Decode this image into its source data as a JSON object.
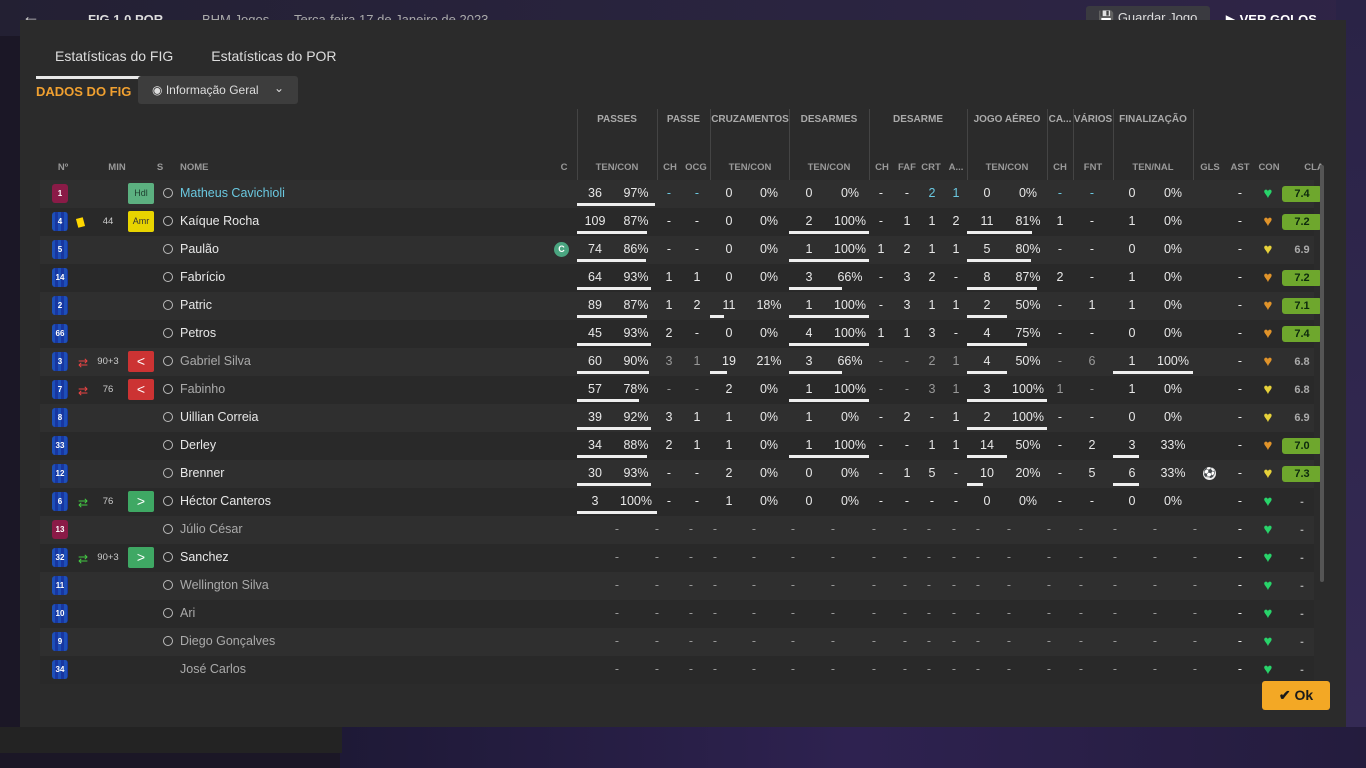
{
  "topbar": {
    "back_icon": "arrow-left-icon",
    "score": "FIG   1   0   POR",
    "stadium": "BHM Jogos",
    "date": "Terça-feira 17 de Janeiro de 2023",
    "save_label": "Guardar Jogo",
    "golos_label": "VER GOLOS"
  },
  "tabs": [
    {
      "label": "Estatísticas do FIG",
      "active": true
    },
    {
      "label": "Estatísticas do POR",
      "active": false
    }
  ],
  "section_title": "DADOS DO FIG",
  "view_dropdown": {
    "label": "Informação Geral",
    "icon": "eye-icon"
  },
  "group_headers": [
    "PASSES",
    "PASSE",
    "CRUZAMENTOS",
    "DESARMES",
    "DESARME",
    "JOGO AÉREO",
    "CA...",
    "VÁRIOS",
    "FINALIZAÇÃO"
  ],
  "column_headers": {
    "num": "Nº",
    "min": "MIN",
    "s": "S",
    "name": "NOME",
    "c": "C",
    "passes": "TEN/CON",
    "ch1": "CH",
    "ocg": "OCG",
    "cruz": "TEN/CON",
    "desarmes": "TEN/CON",
    "ch2": "CH",
    "faf": "FAF",
    "crt": "CRT",
    "a": "A...",
    "aereo": "TEN/CON",
    "ch3": "CH",
    "fnt": "FNT",
    "fin": "TEN/NAL",
    "gls": "GLS",
    "ast": "AST",
    "con": "CON",
    "cla": "CLA"
  },
  "players": [
    {
      "num": "1",
      "kit": "gk",
      "min": "",
      "sub": "",
      "card": "",
      "badge": "Hdl",
      "badge_type": "hdl",
      "name": "Matheus Cavichioli",
      "name_style": "blue",
      "cap": false,
      "pass_t": "36",
      "pass_p": "97%",
      "pass_f": 0.97,
      "ch1": "-",
      "ocg": "-",
      "cr_t": "0",
      "cr_p": "0%",
      "cr_f": 0,
      "de_t": "0",
      "de_p": "0%",
      "de_f": 0,
      "ch2": "-",
      "faf": "-",
      "crt": "2",
      "a": "1",
      "ae_t": "0",
      "ae_p": "0%",
      "ae_f": 0,
      "ch3": "-",
      "fnt": "-",
      "fi_t": "0",
      "fi_p": "0%",
      "fi_f": 0,
      "gls": "",
      "ast": "-",
      "con": "green",
      "cla": "7.4",
      "cla_style": "g",
      "blue_cells": true
    },
    {
      "num": "4",
      "kit": "out",
      "min": "44",
      "sub": "",
      "card": "yellow",
      "badge": "Amr",
      "badge_type": "amr",
      "name": "Kaíque Rocha",
      "name_style": "",
      "cap": false,
      "pass_t": "109",
      "pass_p": "87%",
      "pass_f": 0.87,
      "ch1": "-",
      "ocg": "-",
      "cr_t": "0",
      "cr_p": "0%",
      "cr_f": 0,
      "de_t": "2",
      "de_p": "100%",
      "de_f": 1,
      "ch2": "-",
      "faf": "1",
      "crt": "1",
      "a": "2",
      "ae_t": "11",
      "ae_p": "81%",
      "ae_f": 0.81,
      "ch3": "1",
      "fnt": "-",
      "fi_t": "1",
      "fi_p": "0%",
      "fi_f": 0,
      "gls": "",
      "ast": "-",
      "con": "orange",
      "cla": "7.2",
      "cla_style": "g"
    },
    {
      "num": "5",
      "kit": "out",
      "min": "",
      "sub": "",
      "card": "",
      "badge": "",
      "badge_type": "",
      "name": "Paulão",
      "name_style": "",
      "cap": true,
      "pass_t": "74",
      "pass_p": "86%",
      "pass_f": 0.86,
      "ch1": "-",
      "ocg": "-",
      "cr_t": "0",
      "cr_p": "0%",
      "cr_f": 0,
      "de_t": "1",
      "de_p": "100%",
      "de_f": 1,
      "ch2": "1",
      "faf": "2",
      "crt": "1",
      "a": "1",
      "ae_t": "5",
      "ae_p": "80%",
      "ae_f": 0.8,
      "ch3": "-",
      "fnt": "-",
      "fi_t": "0",
      "fi_p": "0%",
      "fi_f": 0,
      "gls": "",
      "ast": "-",
      "con": "yellow",
      "cla": "6.9",
      "cla_style": "n"
    },
    {
      "num": "14",
      "kit": "out",
      "min": "",
      "sub": "",
      "card": "",
      "badge": "",
      "badge_type": "",
      "name": "Fabrício",
      "name_style": "",
      "cap": false,
      "pass_t": "64",
      "pass_p": "93%",
      "pass_f": 0.93,
      "ch1": "1",
      "ocg": "1",
      "cr_t": "0",
      "cr_p": "0%",
      "cr_f": 0,
      "de_t": "3",
      "de_p": "66%",
      "de_f": 0.66,
      "ch2": "-",
      "faf": "3",
      "crt": "2",
      "a": "-",
      "ae_t": "8",
      "ae_p": "87%",
      "ae_f": 0.87,
      "ch3": "2",
      "fnt": "-",
      "fi_t": "1",
      "fi_p": "0%",
      "fi_f": 0,
      "gls": "",
      "ast": "-",
      "con": "orange",
      "cla": "7.2",
      "cla_style": "g"
    },
    {
      "num": "2",
      "kit": "out",
      "min": "",
      "sub": "",
      "card": "",
      "badge": "",
      "badge_type": "",
      "name": "Patric",
      "name_style": "",
      "cap": false,
      "pass_t": "89",
      "pass_p": "87%",
      "pass_f": 0.87,
      "ch1": "1",
      "ocg": "2",
      "cr_t": "11",
      "cr_p": "18%",
      "cr_f": 0.18,
      "de_t": "1",
      "de_p": "100%",
      "de_f": 1,
      "ch2": "-",
      "faf": "3",
      "crt": "1",
      "a": "1",
      "ae_t": "2",
      "ae_p": "50%",
      "ae_f": 0.5,
      "ch3": "-",
      "fnt": "1",
      "fi_t": "1",
      "fi_p": "0%",
      "fi_f": 0,
      "gls": "",
      "ast": "-",
      "con": "orange",
      "cla": "7.1",
      "cla_style": "g"
    },
    {
      "num": "66",
      "kit": "out",
      "min": "",
      "sub": "",
      "card": "",
      "badge": "",
      "badge_type": "",
      "name": "Petros",
      "name_style": "",
      "cap": false,
      "pass_t": "45",
      "pass_p": "93%",
      "pass_f": 0.93,
      "ch1": "2",
      "ocg": "-",
      "cr_t": "0",
      "cr_p": "0%",
      "cr_f": 0,
      "de_t": "4",
      "de_p": "100%",
      "de_f": 1,
      "ch2": "1",
      "faf": "1",
      "crt": "3",
      "a": "-",
      "ae_t": "4",
      "ae_p": "75%",
      "ae_f": 0.75,
      "ch3": "-",
      "fnt": "-",
      "fi_t": "0",
      "fi_p": "0%",
      "fi_f": 0,
      "gls": "",
      "ast": "-",
      "con": "orange",
      "cla": "7.4",
      "cla_style": "g"
    },
    {
      "num": "3",
      "kit": "out",
      "min": "90+3",
      "sub": "out",
      "card": "",
      "badge": "<",
      "badge_type": "off",
      "name": "Gabriel Silva",
      "name_style": "dim",
      "cap": false,
      "pass_t": "60",
      "pass_p": "90%",
      "pass_f": 0.9,
      "ch1": "3",
      "ocg": "1",
      "cr_t": "19",
      "cr_p": "21%",
      "cr_f": 0.21,
      "de_t": "3",
      "de_p": "66%",
      "de_f": 0.66,
      "ch2": "-",
      "faf": "-",
      "crt": "2",
      "a": "1",
      "ae_t": "4",
      "ae_p": "50%",
      "ae_f": 0.5,
      "ch3": "-",
      "fnt": "6",
      "fi_t": "1",
      "fi_p": "100%",
      "fi_f": 1,
      "gls": "",
      "ast": "-",
      "con": "orange",
      "cla": "6.8",
      "cla_style": "n",
      "dim_cells": true
    },
    {
      "num": "7",
      "kit": "out",
      "min": "76",
      "sub": "out",
      "card": "",
      "badge": "<",
      "badge_type": "off",
      "name": "Fabinho",
      "name_style": "dim",
      "cap": false,
      "pass_t": "57",
      "pass_p": "78%",
      "pass_f": 0.78,
      "ch1": "-",
      "ocg": "-",
      "cr_t": "2",
      "cr_p": "0%",
      "cr_f": 0,
      "de_t": "1",
      "de_p": "100%",
      "de_f": 1,
      "ch2": "-",
      "faf": "-",
      "crt": "3",
      "a": "1",
      "ae_t": "3",
      "ae_p": "100%",
      "ae_f": 1,
      "ch3": "1",
      "fnt": "-",
      "fi_t": "1",
      "fi_p": "0%",
      "fi_f": 0,
      "gls": "",
      "ast": "-",
      "con": "yellow",
      "cla": "6.8",
      "cla_style": "n",
      "dim_cells": true
    },
    {
      "num": "8",
      "kit": "out",
      "min": "",
      "sub": "",
      "card": "",
      "badge": "",
      "badge_type": "",
      "name": "Uillian Correia",
      "name_style": "",
      "cap": false,
      "pass_t": "39",
      "pass_p": "92%",
      "pass_f": 0.92,
      "ch1": "3",
      "ocg": "1",
      "cr_t": "1",
      "cr_p": "0%",
      "cr_f": 0,
      "de_t": "1",
      "de_p": "0%",
      "de_f": 0,
      "ch2": "-",
      "faf": "2",
      "crt": "-",
      "a": "1",
      "ae_t": "2",
      "ae_p": "100%",
      "ae_f": 1,
      "ch3": "-",
      "fnt": "-",
      "fi_t": "0",
      "fi_p": "0%",
      "fi_f": 0,
      "gls": "",
      "ast": "-",
      "con": "yellow",
      "cla": "6.9",
      "cla_style": "n"
    },
    {
      "num": "33",
      "kit": "out",
      "min": "",
      "sub": "",
      "card": "",
      "badge": "",
      "badge_type": "",
      "name": "Derley",
      "name_style": "",
      "cap": false,
      "pass_t": "34",
      "pass_p": "88%",
      "pass_f": 0.88,
      "ch1": "2",
      "ocg": "1",
      "cr_t": "1",
      "cr_p": "0%",
      "cr_f": 0,
      "de_t": "1",
      "de_p": "100%",
      "de_f": 1,
      "ch2": "-",
      "faf": "-",
      "crt": "1",
      "a": "1",
      "ae_t": "14",
      "ae_p": "50%",
      "ae_f": 0.5,
      "ch3": "-",
      "fnt": "2",
      "fi_t": "3",
      "fi_p": "33%",
      "fi_f": 0.33,
      "gls": "",
      "ast": "-",
      "con": "orange",
      "cla": "7.0",
      "cla_style": "g"
    },
    {
      "num": "12",
      "kit": "out",
      "min": "",
      "sub": "",
      "card": "",
      "badge": "",
      "badge_type": "",
      "name": "Brenner",
      "name_style": "",
      "cap": false,
      "pass_t": "30",
      "pass_p": "93%",
      "pass_f": 0.93,
      "ch1": "-",
      "ocg": "-",
      "cr_t": "2",
      "cr_p": "0%",
      "cr_f": 0,
      "de_t": "0",
      "de_p": "0%",
      "de_f": 0,
      "ch2": "-",
      "faf": "1",
      "crt": "5",
      "a": "-",
      "ae_t": "10",
      "ae_p": "20%",
      "ae_f": 0.2,
      "ch3": "-",
      "fnt": "5",
      "fi_t": "6",
      "fi_p": "33%",
      "fi_f": 0.33,
      "gls": "ball",
      "ast": "-",
      "con": "yellow",
      "cla": "7.3",
      "cla_style": "g"
    },
    {
      "num": "6",
      "kit": "out",
      "min": "76",
      "sub": "in",
      "card": "",
      "badge": ">",
      "badge_type": "on",
      "name": "Héctor Canteros",
      "name_style": "",
      "cap": false,
      "pass_t": "3",
      "pass_p": "100%",
      "pass_f": 1,
      "ch1": "-",
      "ocg": "-",
      "cr_t": "1",
      "cr_p": "0%",
      "cr_f": 0,
      "de_t": "0",
      "de_p": "0%",
      "de_f": 0,
      "ch2": "-",
      "faf": "-",
      "crt": "-",
      "a": "-",
      "ae_t": "0",
      "ae_p": "0%",
      "ae_f": 0,
      "ch3": "-",
      "fnt": "-",
      "fi_t": "0",
      "fi_p": "0%",
      "fi_f": 0,
      "gls": "",
      "ast": "-",
      "con": "green",
      "cla": "-",
      "cla_style": "n"
    },
    {
      "num": "13",
      "kit": "gk",
      "min": "",
      "sub": "",
      "card": "",
      "badge": "",
      "badge_type": "",
      "name": "Júlio César",
      "name_style": "dim",
      "cap": false,
      "empty": true,
      "con": "green",
      "cla": "-",
      "cla_style": "n"
    },
    {
      "num": "32",
      "kit": "out",
      "min": "90+3",
      "sub": "in",
      "card": "",
      "badge": ">",
      "badge_type": "on",
      "name": "Sanchez",
      "name_style": "",
      "cap": false,
      "empty": true,
      "con": "green",
      "cla": "-",
      "cla_style": "n"
    },
    {
      "num": "11",
      "kit": "out",
      "min": "",
      "sub": "",
      "card": "",
      "badge": "",
      "badge_type": "",
      "name": "Wellington Silva",
      "name_style": "dim",
      "cap": false,
      "empty": true,
      "con": "green",
      "cla": "-",
      "cla_style": "n"
    },
    {
      "num": "10",
      "kit": "out",
      "min": "",
      "sub": "",
      "card": "",
      "badge": "",
      "badge_type": "",
      "name": "Ari",
      "name_style": "dim",
      "cap": false,
      "empty": true,
      "con": "green",
      "cla": "-",
      "cla_style": "n"
    },
    {
      "num": "9",
      "kit": "out",
      "min": "",
      "sub": "",
      "card": "",
      "badge": "",
      "badge_type": "",
      "name": "Diego Gonçalves",
      "name_style": "dim",
      "cap": false,
      "empty": true,
      "con": "green",
      "cla": "-",
      "cla_style": "n"
    },
    {
      "num": "34",
      "kit": "out",
      "min": "",
      "sub": "",
      "card": "",
      "badge": "",
      "badge_type": "",
      "name": "José Carlos",
      "name_style": "dim",
      "noperson": true,
      "cap": false,
      "empty": true,
      "con": "green",
      "cla": "-",
      "cla_style": "n"
    }
  ],
  "ok_label": "Ok",
  "colors": {
    "accent": "#f3a825",
    "rating_green": "#6ea72d",
    "con_green": "#28d36a",
    "con_orange": "#e0932a",
    "con_yellow": "#e6d13a"
  }
}
